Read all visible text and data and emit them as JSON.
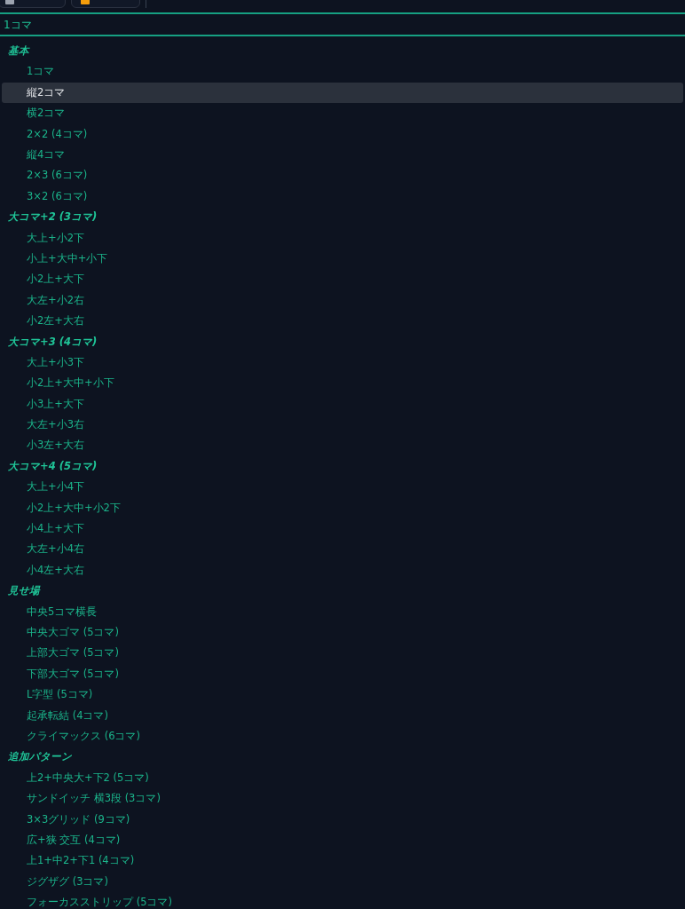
{
  "combobox": {
    "value": "1コマ"
  },
  "groups": [
    {
      "label": "基本",
      "options": [
        {
          "label": "1コマ",
          "selected": false
        },
        {
          "label": "縦2コマ",
          "selected": true
        },
        {
          "label": "横2コマ",
          "selected": false
        },
        {
          "label": "2×2 (4コマ)",
          "selected": false
        },
        {
          "label": "縦4コマ",
          "selected": false
        },
        {
          "label": "2×3 (6コマ)",
          "selected": false
        },
        {
          "label": "3×2 (6コマ)",
          "selected": false
        }
      ]
    },
    {
      "label": "大コマ+2 (3コマ)",
      "options": [
        {
          "label": "大上+小2下",
          "selected": false
        },
        {
          "label": "小上+大中+小下",
          "selected": false
        },
        {
          "label": "小2上+大下",
          "selected": false
        },
        {
          "label": "大左+小2右",
          "selected": false
        },
        {
          "label": "小2左+大右",
          "selected": false
        }
      ]
    },
    {
      "label": "大コマ+3 (4コマ)",
      "options": [
        {
          "label": "大上+小3下",
          "selected": false
        },
        {
          "label": "小2上+大中+小下",
          "selected": false
        },
        {
          "label": "小3上+大下",
          "selected": false
        },
        {
          "label": "大左+小3右",
          "selected": false
        },
        {
          "label": "小3左+大右",
          "selected": false
        }
      ]
    },
    {
      "label": "大コマ+4 (5コマ)",
      "options": [
        {
          "label": "大上+小4下",
          "selected": false
        },
        {
          "label": "小2上+大中+小2下",
          "selected": false
        },
        {
          "label": "小4上+大下",
          "selected": false
        },
        {
          "label": "大左+小4右",
          "selected": false
        },
        {
          "label": "小4左+大右",
          "selected": false
        }
      ]
    },
    {
      "label": "見せ場",
      "options": [
        {
          "label": "中央5コマ横長",
          "selected": false
        },
        {
          "label": "中央大ゴマ (5コマ)",
          "selected": false
        },
        {
          "label": "上部大ゴマ (5コマ)",
          "selected": false
        },
        {
          "label": "下部大ゴマ (5コマ)",
          "selected": false
        },
        {
          "label": "L字型 (5コマ)",
          "selected": false
        },
        {
          "label": "起承転結 (4コマ)",
          "selected": false
        },
        {
          "label": "クライマックス (6コマ)",
          "selected": false
        }
      ]
    },
    {
      "label": "追加パターン",
      "options": [
        {
          "label": "上2+中央大+下2 (5コマ)",
          "selected": false
        },
        {
          "label": "サンドイッチ 横3段 (3コマ)",
          "selected": false
        },
        {
          "label": "3×3グリッド (9コマ)",
          "selected": false
        },
        {
          "label": "広+狭 交互 (4コマ)",
          "selected": false
        },
        {
          "label": "上1+中2+下1 (4コマ)",
          "selected": false
        },
        {
          "label": "ジグザグ (3コマ)",
          "selected": false
        },
        {
          "label": "フォーカスストリップ (5コマ)",
          "selected": false
        }
      ]
    }
  ]
}
